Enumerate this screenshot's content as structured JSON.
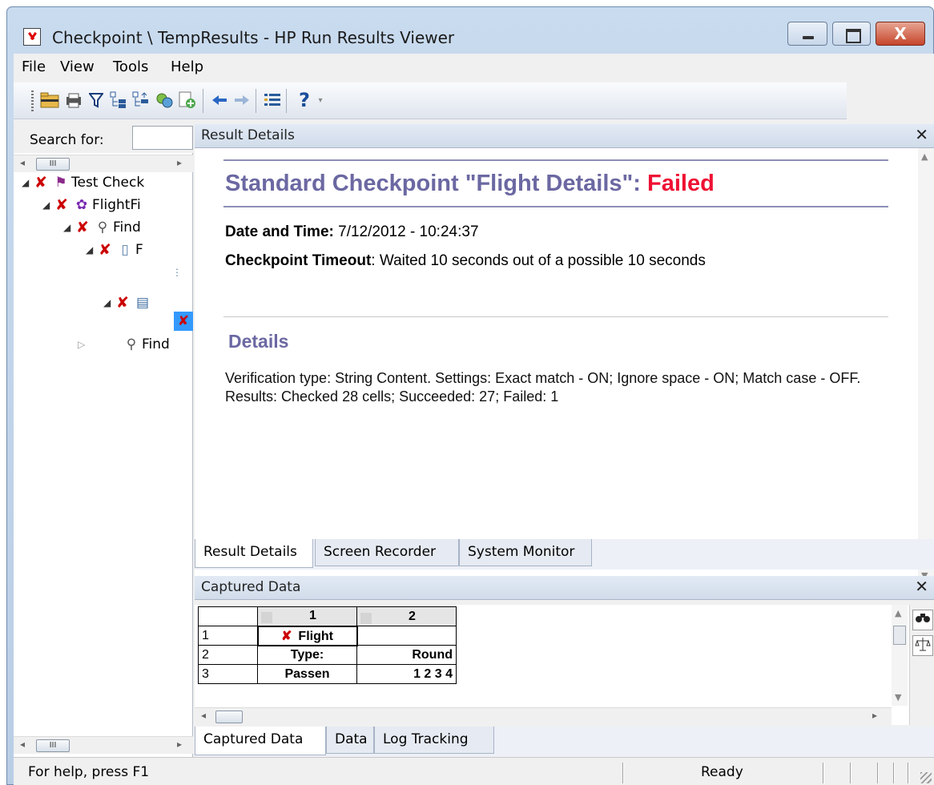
{
  "window": {
    "title": "Checkpoint \\ TempResults - HP Run Results Viewer",
    "close_glyph": "X"
  },
  "menu": [
    "File",
    "View",
    "Tools",
    "Help"
  ],
  "toolbar": {
    "icons": [
      "open-folder-icon",
      "print-icon",
      "filter-icon",
      "expand-all-icon",
      "collapse-all-icon",
      "go-to-node-icon",
      "export-icon",
      "back-icon",
      "forward-icon",
      "list-icon",
      "help-icon"
    ],
    "help_glyph": "?"
  },
  "left_pane": {
    "search_label": "Search for:",
    "scroll_thumb": "III",
    "tree": [
      {
        "label": "Test Check",
        "status": "failed"
      },
      {
        "label": "FlightFi",
        "status": "failed"
      },
      {
        "label": "Find",
        "status": "failed"
      },
      {
        "label": "F",
        "status": "failed"
      },
      {
        "label": "Find",
        "status": "none"
      }
    ]
  },
  "result_details": {
    "pane_title": "Result Details",
    "heading_prefix": "Standard Checkpoint \"Flight Details\": ",
    "heading_status": "Failed",
    "date_label": "Date and Time:",
    "date_value": " 7/12/2012 - 10:24:37",
    "timeout_label": "Checkpoint Timeout",
    "timeout_value": ": Waited 10 seconds out of a possible 10 seconds",
    "details_heading": "Details",
    "details_text": "Verification type: String Content. Settings: Exact match - ON; Ignore space - ON; Match case - OFF. Results: Checked 28 cells; Succeeded: 27; Failed: 1"
  },
  "result_tabs": [
    "Result Details",
    "Screen Recorder",
    "System Monitor"
  ],
  "captured_data": {
    "pane_title": "Captured Data",
    "columns": [
      "1",
      "2"
    ],
    "rows": [
      {
        "n": "1",
        "c1": "Flight",
        "c2": "",
        "failed": true
      },
      {
        "n": "2",
        "c1": "Type:",
        "c2": "Round",
        "failed": false
      },
      {
        "n": "3",
        "c1": "Passen",
        "c2": "1 2 3 4",
        "failed": false
      }
    ]
  },
  "bottom_tabs": [
    "Captured Data",
    "Data",
    "Log Tracking"
  ],
  "status": {
    "help": "For help, press F1",
    "state": "Ready"
  },
  "colors": {
    "heading": "#6b68a2",
    "failed": "#ee1133",
    "error_mark": "#cc0000"
  }
}
